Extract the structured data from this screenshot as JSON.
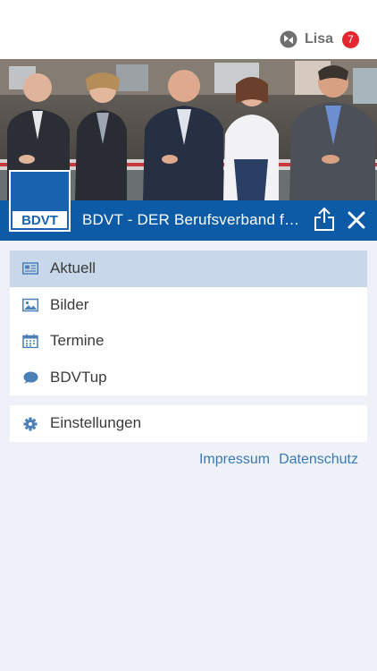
{
  "header": {
    "user_name": "Lisa",
    "notification_count": "7",
    "user_icon": "user-switch-icon"
  },
  "banner": {
    "title": "BDVT - DER Berufsverband fü...",
    "logo_text": "BDVT",
    "share_icon": "share-icon",
    "close_icon": "close-icon"
  },
  "menu": {
    "items": [
      {
        "label": "Aktuell",
        "icon": "news-icon",
        "active": true
      },
      {
        "label": "Bilder",
        "icon": "image-icon",
        "active": false
      },
      {
        "label": "Termine",
        "icon": "calendar-icon",
        "active": false
      },
      {
        "label": "BDVTup",
        "icon": "chat-bubble-icon",
        "active": false
      }
    ],
    "settings": {
      "label": "Einstellungen",
      "icon": "gear-icon"
    }
  },
  "footer_links": {
    "impressum": "Impressum",
    "datenschutz": "Datenschutz"
  },
  "colors": {
    "brand_blue": "#0d5aa7",
    "active_item": "#c8d7ea",
    "icon_blue": "#4a7fb8",
    "link_blue": "#3b78b4",
    "badge_red": "#e4262e",
    "background": "#eef2f8"
  }
}
